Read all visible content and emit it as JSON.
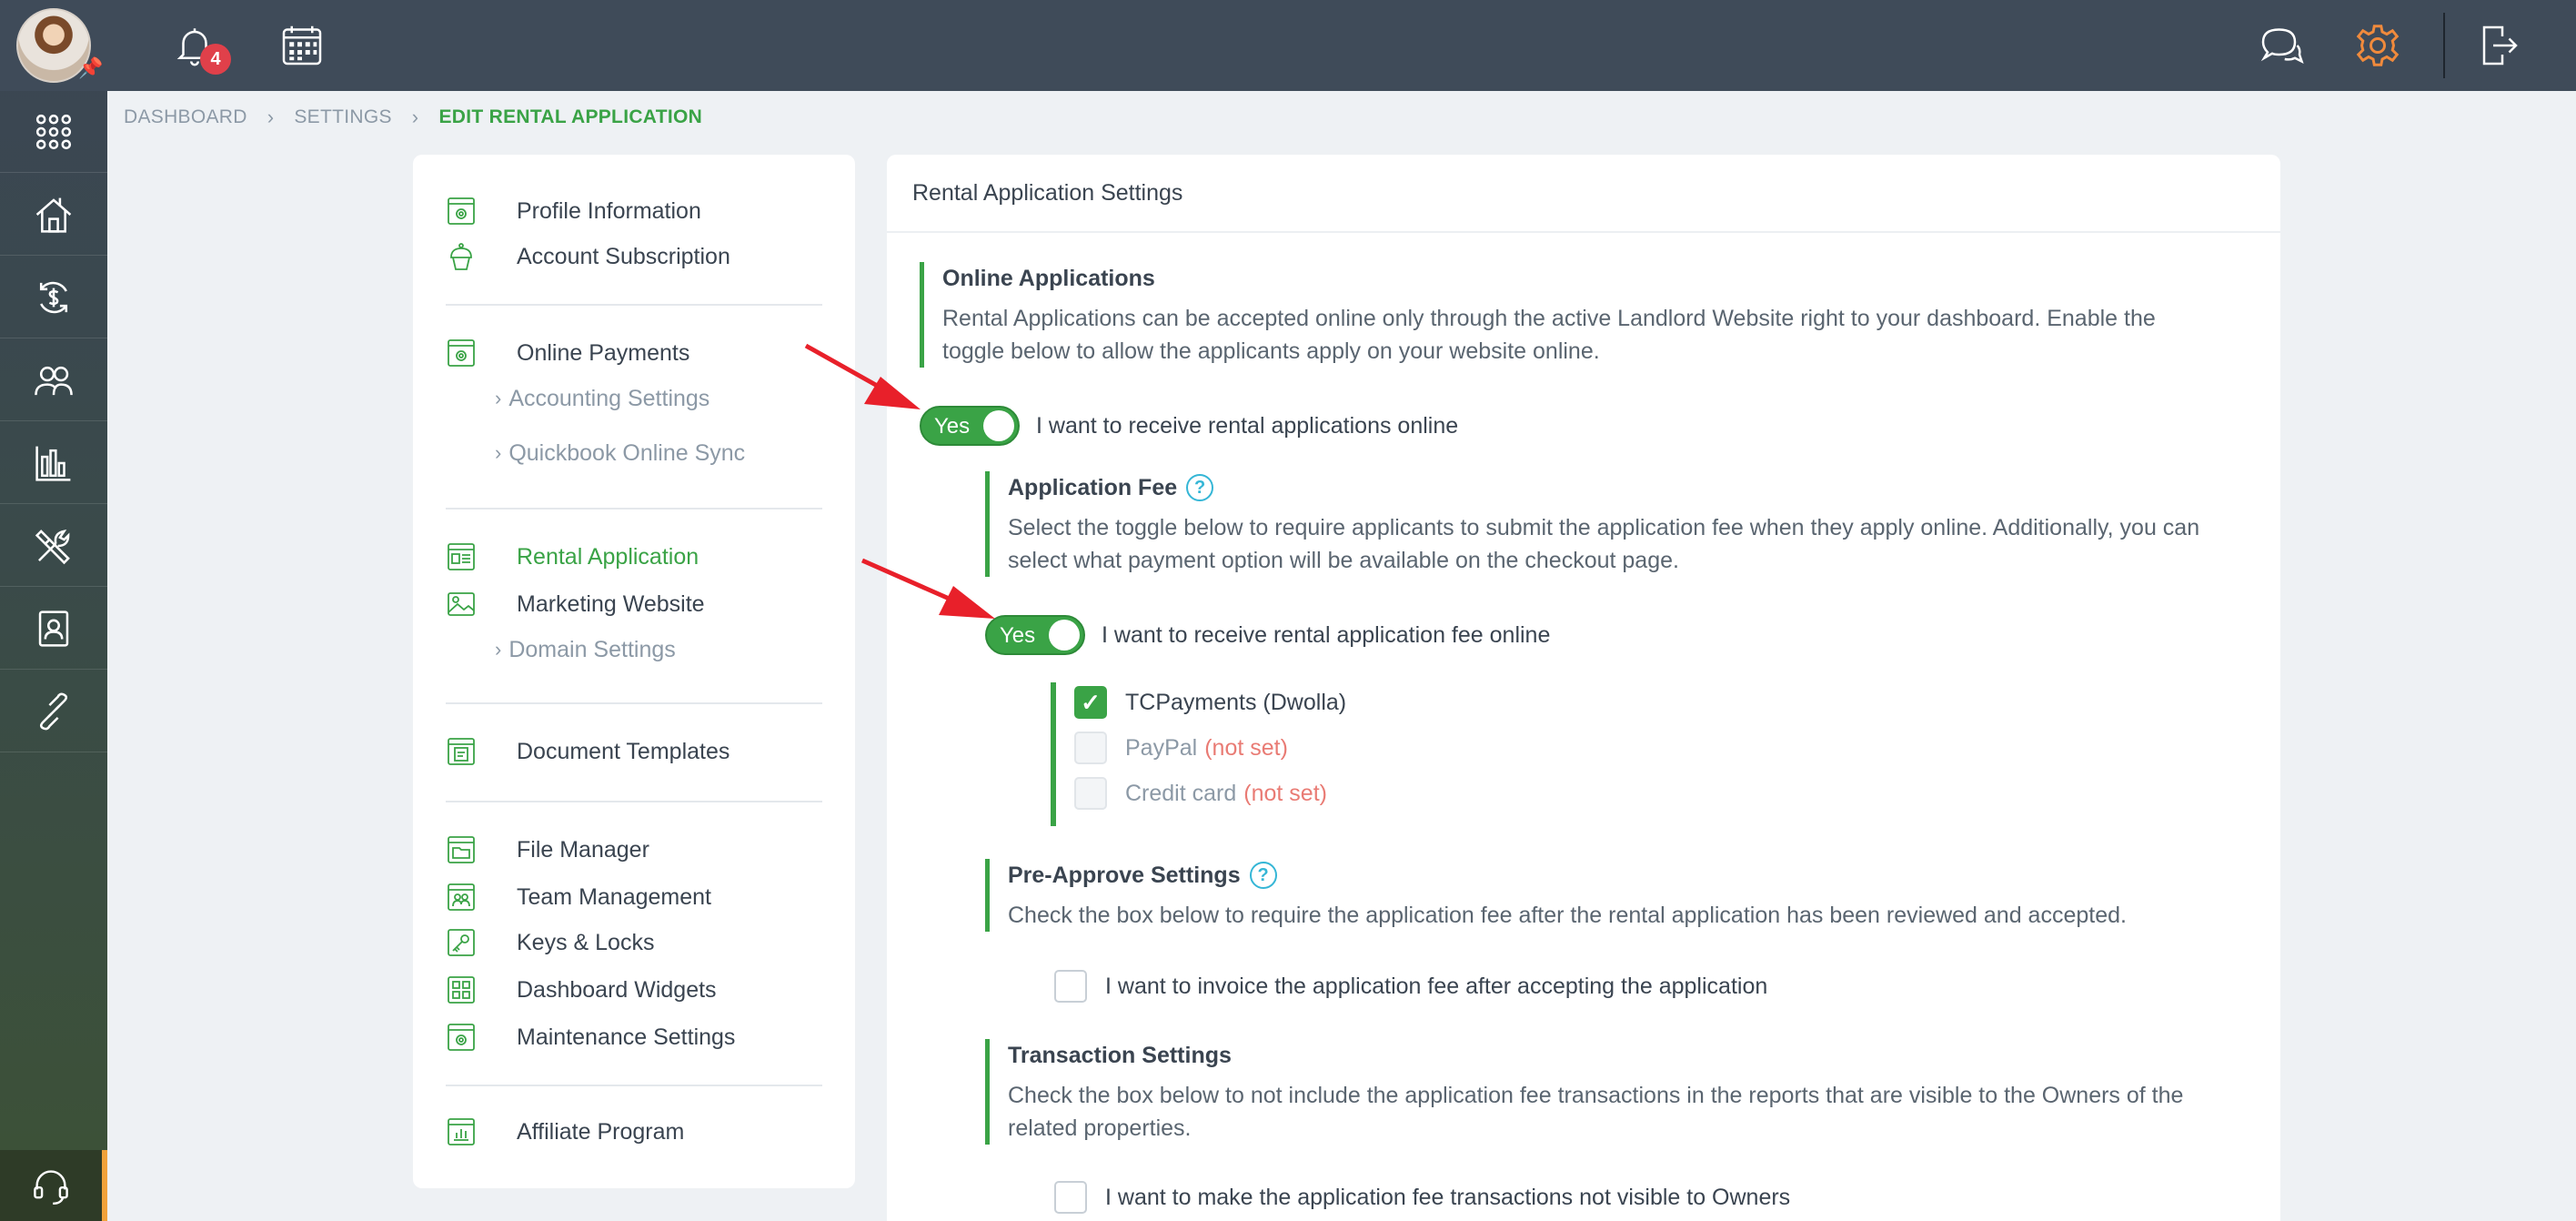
{
  "topbar": {
    "notification_count": "4",
    "icons": [
      "bell-icon",
      "calendar-icon",
      "chat-icon",
      "gear-icon",
      "logout-icon"
    ]
  },
  "sidebar": {
    "icons": [
      "apps-grid-icon",
      "properties-icon",
      "payments-icon",
      "people-icon",
      "reports-icon",
      "tools-icon",
      "contacts-icon",
      "link-icon",
      "support-headset-icon"
    ]
  },
  "breadcrumb": {
    "items": [
      "DASHBOARD",
      "SETTINGS",
      "EDIT RENTAL APPLICATION"
    ]
  },
  "settings_nav": {
    "groups": [
      {
        "items": [
          {
            "label": "Profile Information",
            "icon": "profile-icon"
          },
          {
            "label": "Account Subscription",
            "icon": "cupcake-icon"
          }
        ]
      },
      {
        "items": [
          {
            "label": "Online Payments",
            "icon": "payments-icon"
          }
        ],
        "subs": [
          "Accounting Settings",
          "Quickbook Online Sync"
        ]
      },
      {
        "items": [
          {
            "label": "Rental Application",
            "icon": "application-icon",
            "active": true
          },
          {
            "label": "Marketing Website",
            "icon": "image-icon"
          }
        ],
        "subs": [
          "Domain Settings"
        ]
      },
      {
        "items": [
          {
            "label": "Document Templates",
            "icon": "document-icon"
          }
        ]
      },
      {
        "items": [
          {
            "label": "File Manager",
            "icon": "folder-icon"
          },
          {
            "label": "Team Management",
            "icon": "team-icon"
          },
          {
            "label": "Keys & Locks",
            "icon": "key-icon"
          },
          {
            "label": "Dashboard Widgets",
            "icon": "widgets-icon"
          },
          {
            "label": "Maintenance Settings",
            "icon": "maintenance-icon"
          }
        ]
      },
      {
        "items": [
          {
            "label": "Affiliate Program",
            "icon": "affiliate-icon"
          }
        ]
      }
    ]
  },
  "main": {
    "header": "Rental Application Settings",
    "online": {
      "title": "Online Applications",
      "desc": "Rental Applications can be accepted online only through the active Landlord Website right to your dashboard. Enable the toggle below to allow the applicants apply on your website online.",
      "toggle_label": "Yes",
      "toggle_text": "I want to receive rental applications online"
    },
    "fee": {
      "title": "Application Fee",
      "help": "?",
      "desc": "Select the toggle below to require applicants to submit the application fee when they apply online. Additionally, you can select what payment option will be available on the checkout page.",
      "toggle_label": "Yes",
      "toggle_text": "I want to receive rental application fee online",
      "options": [
        {
          "label": "TCPayments (Dwolla)",
          "checked": true,
          "status": ""
        },
        {
          "label": "PayPal",
          "checked": false,
          "status": "(not set)"
        },
        {
          "label": "Credit card",
          "checked": false,
          "status": "(not set)"
        }
      ],
      "check_mark": "✓"
    },
    "preapprove": {
      "title": "Pre-Approve Settings",
      "help": "?",
      "desc": "Check the box below to require the application fee after the rental application has been reviewed and accepted.",
      "checkbox_text": "I want to invoice the application fee after accepting the application"
    },
    "transaction": {
      "title": "Transaction Settings",
      "desc": "Check the box below to not include the application fee transactions in the reports that are visible to the Owners of the related properties.",
      "checkbox_text": "I want to make the application fee transactions not visible to Owners"
    }
  },
  "colors": {
    "accent_green": "#3aa346",
    "topbar": "#3f4b59",
    "notset_red": "#e97b74",
    "annotation_red": "#e8202a",
    "gear_orange": "#f08a3c"
  }
}
